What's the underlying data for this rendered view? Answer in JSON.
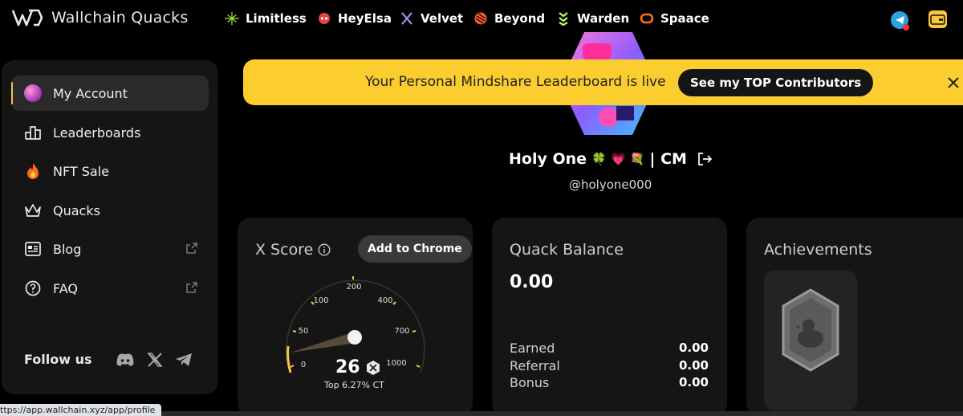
{
  "brand": {
    "name": "Wallchain Quacks"
  },
  "partners": [
    {
      "label": "Limitless",
      "icon": "limitless-icon",
      "color": "#9be34b"
    },
    {
      "label": "HeyElsa",
      "icon": "heyelsa-icon",
      "color": "#e8423f"
    },
    {
      "label": "Velvet",
      "icon": "velvet-icon",
      "color": "#a58cf0"
    },
    {
      "label": "Beyond",
      "icon": "beyond-icon",
      "color": "#ff5a2a"
    },
    {
      "label": "Warden",
      "icon": "warden-icon",
      "color": "#b6f26b"
    },
    {
      "label": "Spaace",
      "icon": "spaace-icon",
      "color": "#ff6a1f"
    }
  ],
  "sidebar": {
    "items": [
      {
        "label": "My Account",
        "icon": "avatar-icon",
        "active": true
      },
      {
        "label": "Leaderboards",
        "icon": "leaderboard-icon"
      },
      {
        "label": "NFT Sale",
        "icon": "fire-icon"
      },
      {
        "label": "Quacks",
        "icon": "crown-icon"
      },
      {
        "label": "Blog",
        "icon": "blog-icon",
        "external": true
      },
      {
        "label": "FAQ",
        "icon": "question-icon",
        "external": true
      }
    ],
    "follow_label": "Follow us"
  },
  "banner": {
    "text": "Your Personal Mindshare Leaderboard is live",
    "button": "See my TOP Contributors"
  },
  "profile": {
    "name": "Holy One",
    "name_suffix": "| CM",
    "emojis": "🍀 💗 💐",
    "handle": "@holyone000"
  },
  "x_score": {
    "title": "X Score",
    "button": "Add to Chrome",
    "score": "26",
    "rank": "Top 6.27% CT",
    "ticks": [
      "0",
      "50",
      "100",
      "200",
      "400",
      "700",
      "1000"
    ],
    "accent": "#f6c544"
  },
  "quack_balance": {
    "title": "Quack Balance",
    "value": "0.00",
    "rows": [
      {
        "label": "Earned",
        "value": "0.00"
      },
      {
        "label": "Referral",
        "value": "0.00"
      },
      {
        "label": "Bonus",
        "value": "0.00"
      }
    ]
  },
  "achievements": {
    "title": "Achievements"
  },
  "status_url": "ttps://app.wallchain.xyz/app/profile"
}
